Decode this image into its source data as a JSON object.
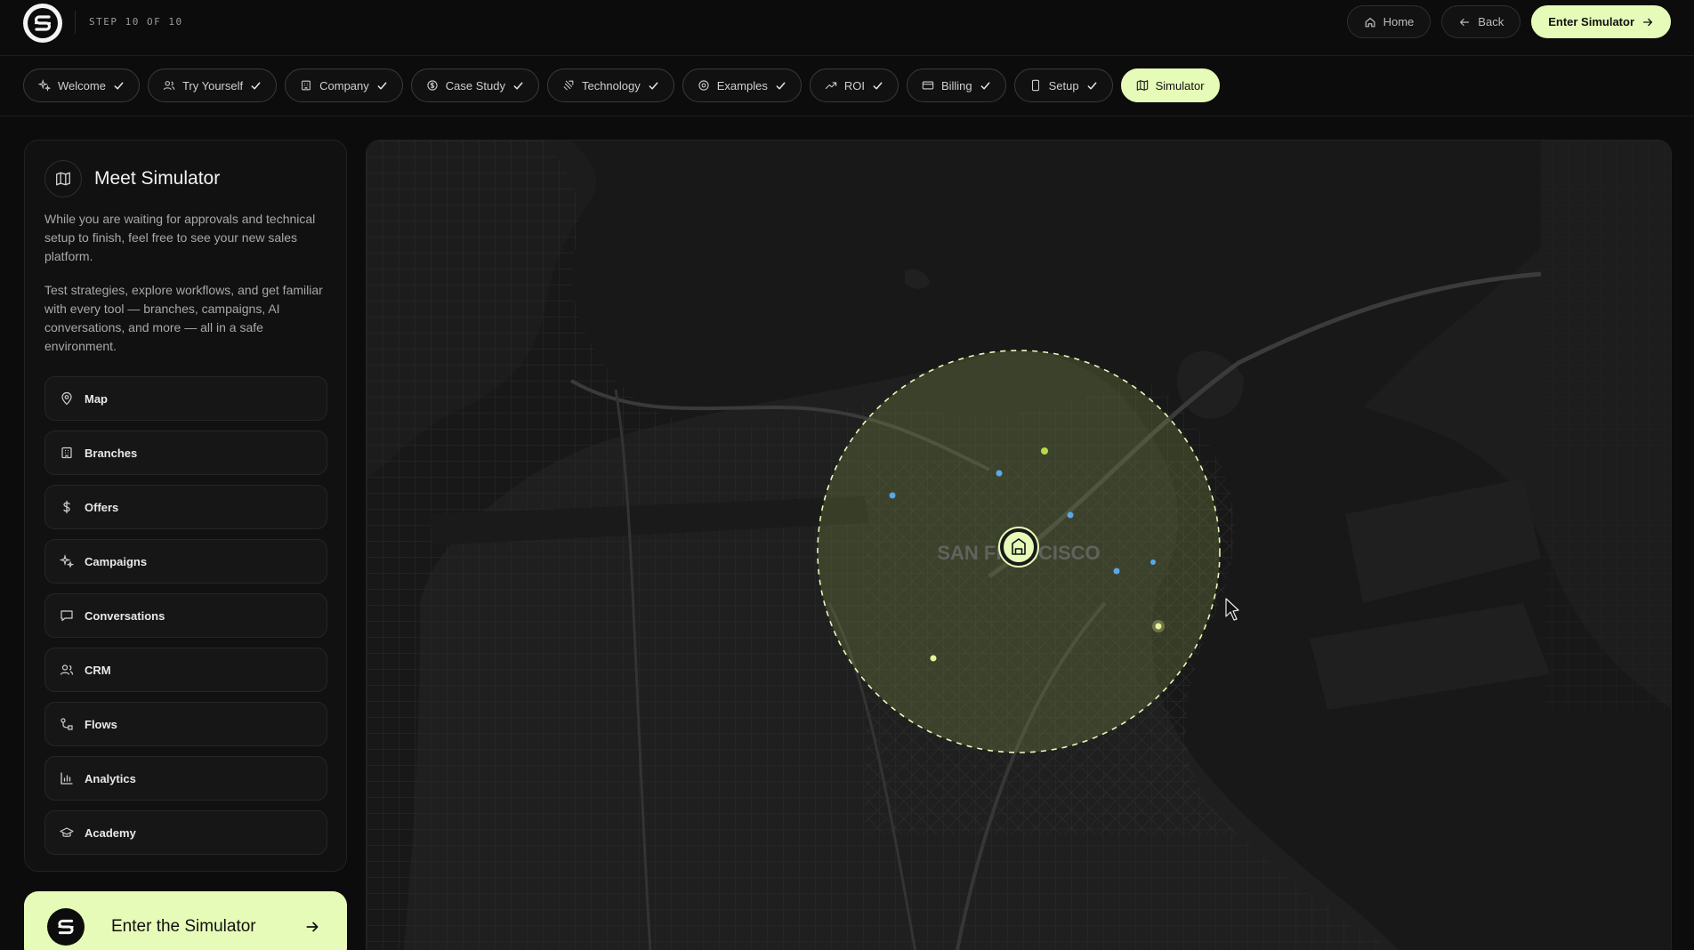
{
  "header": {
    "step_text": "STEP 10 OF 10",
    "home_label": "Home",
    "back_label": "Back",
    "enter_label": "Enter Simulator"
  },
  "steps": [
    {
      "label": "Welcome",
      "icon": "sparkles-icon",
      "done": true
    },
    {
      "label": "Try Yourself",
      "icon": "users-icon",
      "done": true
    },
    {
      "label": "Company",
      "icon": "building-icon",
      "done": true
    },
    {
      "label": "Case Study",
      "icon": "coin-icon",
      "done": true
    },
    {
      "label": "Technology",
      "icon": "chip-icon",
      "done": true
    },
    {
      "label": "Examples",
      "icon": "target-icon",
      "done": true
    },
    {
      "label": "ROI",
      "icon": "trend-icon",
      "done": true
    },
    {
      "label": "Billing",
      "icon": "card-icon",
      "done": true
    },
    {
      "label": "Setup",
      "icon": "phone-icon",
      "done": true
    },
    {
      "label": "Simulator",
      "icon": "map-icon",
      "done": false,
      "active": true
    }
  ],
  "sidebar": {
    "title": "Meet Simulator",
    "paragraph1": "While you are waiting for approvals and technical setup to finish, feel free to see your new sales platform.",
    "paragraph2": "Test strategies, explore workflows, and get familiar with every tool — branches, campaigns, AI conversations, and more — all in a safe environment.",
    "items": [
      {
        "label": "Map",
        "icon": "pin-icon"
      },
      {
        "label": "Branches",
        "icon": "building-icon"
      },
      {
        "label": "Offers",
        "icon": "dollar-icon"
      },
      {
        "label": "Campaigns",
        "icon": "sparkles-icon"
      },
      {
        "label": "Conversations",
        "icon": "chat-icon"
      },
      {
        "label": "CRM",
        "icon": "users-icon"
      },
      {
        "label": "Flows",
        "icon": "flow-icon"
      },
      {
        "label": "Analytics",
        "icon": "bar-chart-icon"
      },
      {
        "label": "Academy",
        "icon": "graduation-icon"
      }
    ]
  },
  "enter_card": {
    "label": "Enter the Simulator"
  },
  "map": {
    "city_label": "SAN FRANCISCO",
    "colors": {
      "accent": "#e6fbb8",
      "circle_fill": "#8a9a4a",
      "dot_blue": "#5aa9e6",
      "dot_yellow": "#e8f29a"
    }
  }
}
